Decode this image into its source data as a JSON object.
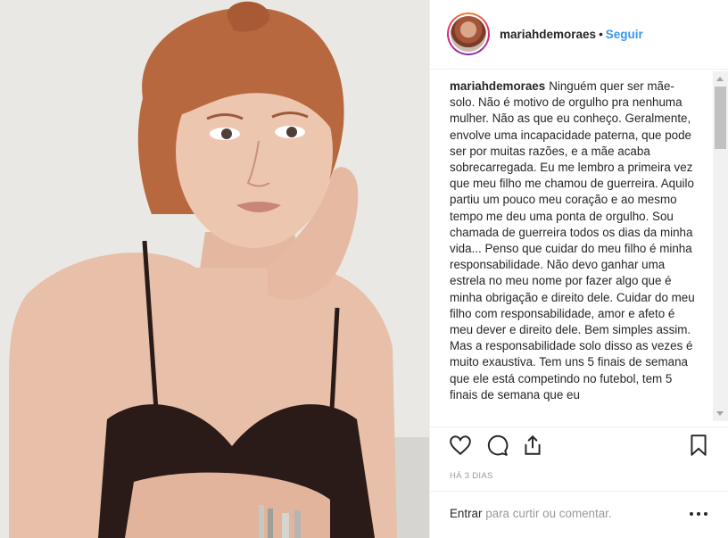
{
  "post": {
    "username": "mariahdemoraes",
    "separator": "•",
    "follow_label": "Seguir",
    "caption": "Ninguém quer ser mãe-solo. Não é motivo de orgulho pra nenhuma mulher. Não as que eu conheço. Geralmente, envolve uma incapacidade paterna, que pode ser por muitas razões, e a mãe acaba sobrecarregada. Eu me lembro a primeira vez que meu filho me chamou de guerreira. Aquilo partiu um pouco meu coração e ao mesmo tempo me deu uma ponta de orgulho. Sou chamada de guerreira todos os dias da minha vida... Penso que cuidar do meu filho é minha responsabilidade. Não devo ganhar uma estrela no meu nome por fazer algo que é minha obrigação e direito dele. Cuidar do meu filho com responsabilidade, amor e afeto é meu dever e direito dele. Bem simples assim. Mas a responsabilidade solo disso as vezes é muito exaustiva. Tem uns 5 finais de semana que ele está competindo no futebol, tem 5 finais de semana que eu",
    "timestamp": "HÁ 3 DIAS"
  },
  "actions": {
    "icons": [
      "heart-icon",
      "comment-icon",
      "share-icon",
      "bookmark-icon"
    ]
  },
  "comment": {
    "login_label": "Entrar",
    "prompt": " para curtir ou comentar."
  },
  "colors": {
    "link": "#3897f0",
    "text": "#262626",
    "muted": "#999999",
    "border": "#efefef"
  }
}
